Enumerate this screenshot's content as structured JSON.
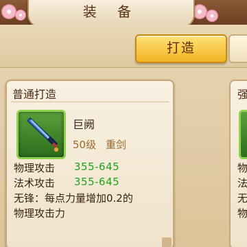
{
  "title": "装 备",
  "tabs": {
    "active_label": "打造"
  },
  "card": {
    "header": "普通打造",
    "item": {
      "name": "巨阙",
      "level": "50级",
      "type": "重剑",
      "icon": "sword-icon"
    },
    "stats": [
      {
        "label": "物理攻击",
        "value": "355-645"
      },
      {
        "label": "法术攻击",
        "value": "355-645"
      }
    ],
    "effect_line1": "无锋：每点力量增加0.2的",
    "effect_line2": "物理攻击力"
  },
  "next_card": {
    "header_peek": "强",
    "line_peek1": "物",
    "line_peek2": "法",
    "line_peek3": "无",
    "line_peek4": "物"
  },
  "colors": {
    "accent_tab": "#f2b322",
    "stat_value": "#1fa31c",
    "item_rarity_green": "#8fd14f"
  }
}
